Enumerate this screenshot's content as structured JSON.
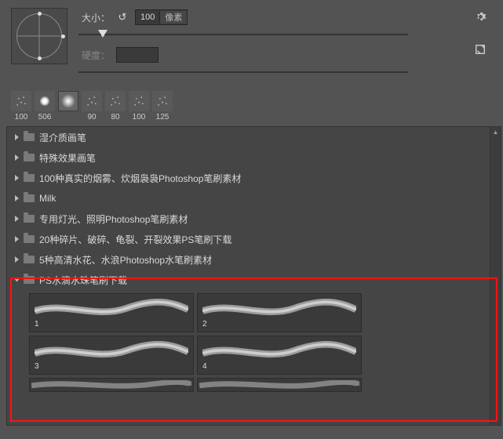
{
  "header": {
    "size_label": "大小：",
    "size_value": "100",
    "size_unit": "像素",
    "hardness_label": "硬度：",
    "hardness_value": "",
    "slider_pos_size": 12,
    "gear_tip": "设置",
    "newdoc_tip": "新建"
  },
  "presets": [
    {
      "size": "100",
      "kind": "spray"
    },
    {
      "size": "506",
      "kind": "fuz2"
    },
    {
      "size": "",
      "kind": "fuzzy",
      "selected": true
    },
    {
      "size": "90",
      "kind": "spray"
    },
    {
      "size": "80",
      "kind": "spray"
    },
    {
      "size": "100",
      "kind": "spray"
    },
    {
      "size": "125",
      "kind": "spray"
    }
  ],
  "folders": [
    {
      "name": "湿介质画笔",
      "open": false
    },
    {
      "name": "特殊效果画笔",
      "open": false
    },
    {
      "name": "100种真实的烟雾、炊烟袅袅Photoshop笔刷素材",
      "open": false
    },
    {
      "name": "Milk",
      "open": false
    },
    {
      "name": "专用灯光、照明Photoshop笔刷素材",
      "open": false
    },
    {
      "name": "20种碎片、破碎、龟裂、开裂效果PS笔刷下载",
      "open": false
    },
    {
      "name": "5种高清水花、水浪Photoshop水笔刷素材",
      "open": false
    },
    {
      "name": "PS水滴水珠笔刷下载",
      "open": true
    }
  ],
  "thumbs": [
    {
      "label": "1"
    },
    {
      "label": "2"
    },
    {
      "label": "3"
    },
    {
      "label": "4"
    }
  ]
}
